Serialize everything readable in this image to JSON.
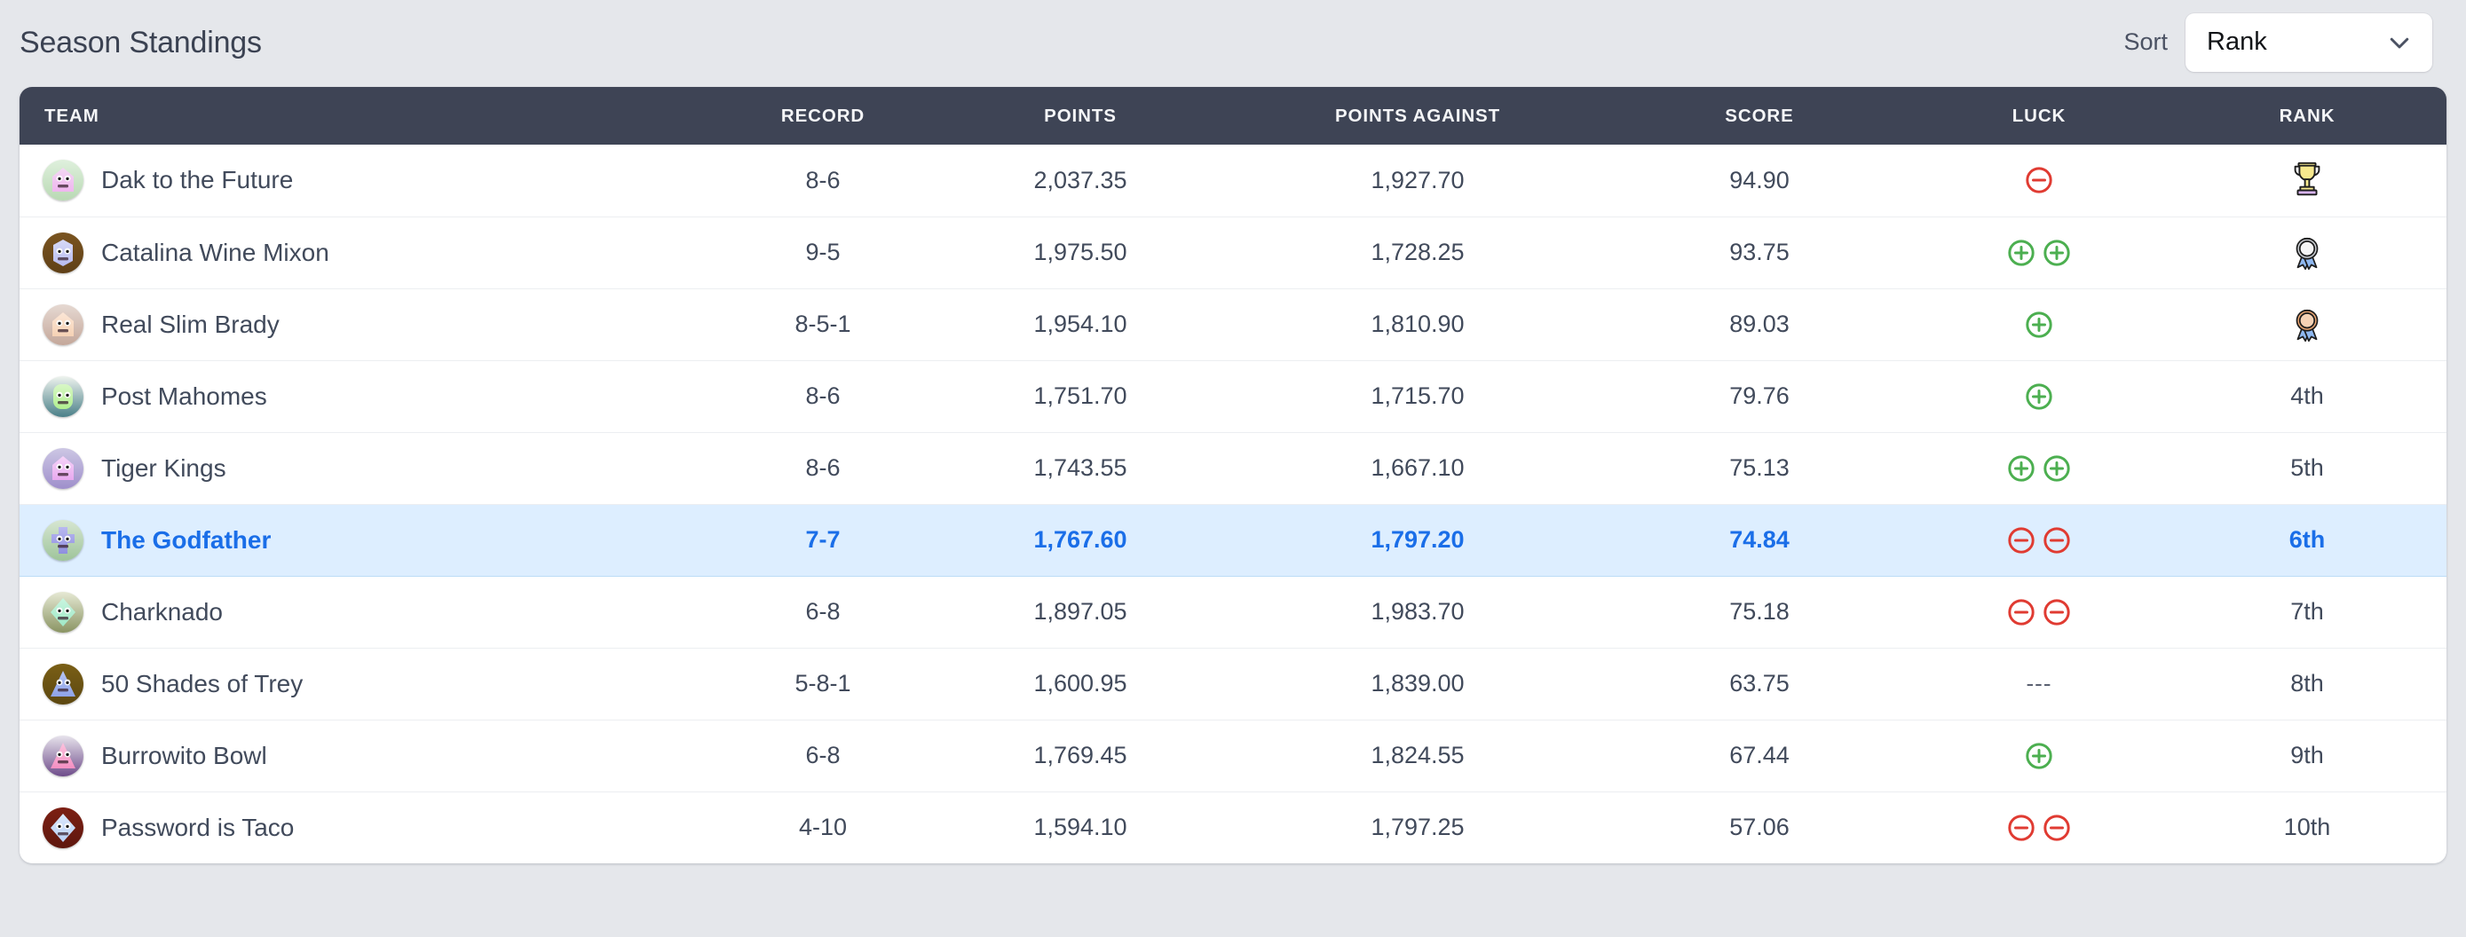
{
  "header": {
    "title": "Season Standings",
    "sort_label": "Sort",
    "sort_value": "Rank",
    "sort_options": [
      "Rank"
    ],
    "chevron_icon": "chevron-down-icon"
  },
  "table": {
    "columns": [
      "TEAM",
      "RECORD",
      "POINTS",
      "POINTS AGAINST",
      "SCORE",
      "LUCK",
      "RANK"
    ],
    "rows": [
      {
        "team": "Dak to the Future",
        "record": "8-6",
        "points": "2,037.35",
        "points_against": "1,927.70",
        "score": "94.90",
        "luck": [
          "minus"
        ],
        "rank": "1st",
        "rank_icon": "trophy-icon",
        "highlighted": false,
        "avatar": {
          "bg1": "#dff0dd",
          "bg2": "#b9d9b4",
          "face": "#efb6ef",
          "shape": "pentagon",
          "accent": "#f3d9f3"
        }
      },
      {
        "team": "Catalina Wine Mixon",
        "record": "9-5",
        "points": "1,975.50",
        "points_against": "1,728.25",
        "score": "93.75",
        "luck": [
          "plus",
          "plus"
        ],
        "rank": "2nd",
        "rank_icon": "silver-medal-icon",
        "highlighted": false,
        "avatar": {
          "bg1": "#7a5420",
          "bg2": "#5f4017",
          "face": "#b9bcf0",
          "shape": "hex",
          "accent": "#d7d9f7"
        }
      },
      {
        "team": "Real Slim Brady",
        "record": "8-5-1",
        "points": "1,954.10",
        "points_against": "1,810.90",
        "score": "89.03",
        "luck": [
          "plus"
        ],
        "rank": "3rd",
        "rank_icon": "bronze-medal-icon",
        "highlighted": false,
        "avatar": {
          "bg1": "#e6d9d2",
          "bg2": "#c4a79a",
          "face": "#f6d2b5",
          "shape": "pentagon",
          "accent": "#fbe6d6"
        }
      },
      {
        "team": "Post Mahomes",
        "record": "8-6",
        "points": "1,751.70",
        "points_against": "1,715.70",
        "score": "79.76",
        "luck": [
          "plus"
        ],
        "rank": "4th",
        "rank_icon": "",
        "highlighted": false,
        "avatar": {
          "bg1": "#eef3ee",
          "bg2": "#4a7f88",
          "face": "#b1ef8f",
          "shape": "rounded",
          "accent": "#d8f7c6"
        }
      },
      {
        "team": "Tiger Kings",
        "record": "8-6",
        "points": "1,743.55",
        "points_against": "1,667.10",
        "score": "75.13",
        "luck": [
          "plus",
          "plus"
        ],
        "rank": "5th",
        "rank_icon": "",
        "highlighted": false,
        "avatar": {
          "bg1": "#cdc7e4",
          "bg2": "#9f8fcb",
          "face": "#e8a9ef",
          "shape": "pentagon",
          "accent": "#f5d4f8"
        }
      },
      {
        "team": "The Godfather",
        "record": "7-7",
        "points": "1,767.60",
        "points_against": "1,797.20",
        "score": "74.84",
        "luck": [
          "minus",
          "minus"
        ],
        "rank": "6th",
        "rank_icon": "",
        "highlighted": true,
        "avatar": {
          "bg1": "#d7e6d2",
          "bg2": "#9ec49a",
          "face": "#8e8ee0",
          "shape": "cross",
          "accent": "#b9b9f0"
        }
      },
      {
        "team": "Charknado",
        "record": "6-8",
        "points": "1,897.05",
        "points_against": "1,983.70",
        "score": "75.18",
        "luck": [
          "minus",
          "minus"
        ],
        "rank": "7th",
        "rank_icon": "",
        "highlighted": false,
        "avatar": {
          "bg1": "#e6e9d4",
          "bg2": "#8a9463",
          "face": "#9fe8c6",
          "shape": "diamond",
          "accent": "#c9f5e0"
        }
      },
      {
        "team": "50 Shades of Trey",
        "record": "5-8-1",
        "points": "1,600.95",
        "points_against": "1,839.00",
        "score": "63.75",
        "luck": [],
        "luck_none": "---",
        "rank": "8th",
        "rank_icon": "",
        "highlighted": false,
        "avatar": {
          "bg1": "#7a5f16",
          "bg2": "#5c4710",
          "face": "#8fa3e8",
          "shape": "triangle",
          "accent": "#b6c4f2"
        }
      },
      {
        "team": "Burrowito Bowl",
        "record": "6-8",
        "points": "1,769.45",
        "points_against": "1,824.55",
        "score": "67.44",
        "luck": [
          "plus"
        ],
        "rank": "9th",
        "rank_icon": "",
        "highlighted": false,
        "avatar": {
          "bg1": "#e7e3ec",
          "bg2": "#6e4c8a",
          "face": "#f48fc2",
          "shape": "triangle",
          "accent": "#fbc3dd"
        }
      },
      {
        "team": "Password is Taco",
        "record": "4-10",
        "points": "1,594.10",
        "points_against": "1,797.25",
        "score": "57.06",
        "luck": [
          "minus",
          "minus"
        ],
        "rank": "10th",
        "rank_icon": "",
        "highlighted": false,
        "avatar": {
          "bg1": "#7d1f13",
          "bg2": "#5e170e",
          "face": "#b9cff5",
          "shape": "diamond",
          "accent": "#dbe8fb"
        }
      }
    ]
  },
  "colors": {
    "page_bg": "#e5e7eb",
    "header_bg": "#3e4455",
    "card_bg": "#ffffff",
    "text": "#414a5b",
    "highlight_bg": "#ddeeff",
    "highlight_text": "#1a6ee8",
    "luck_plus": "#4caf50",
    "luck_minus": "#e03b32"
  }
}
